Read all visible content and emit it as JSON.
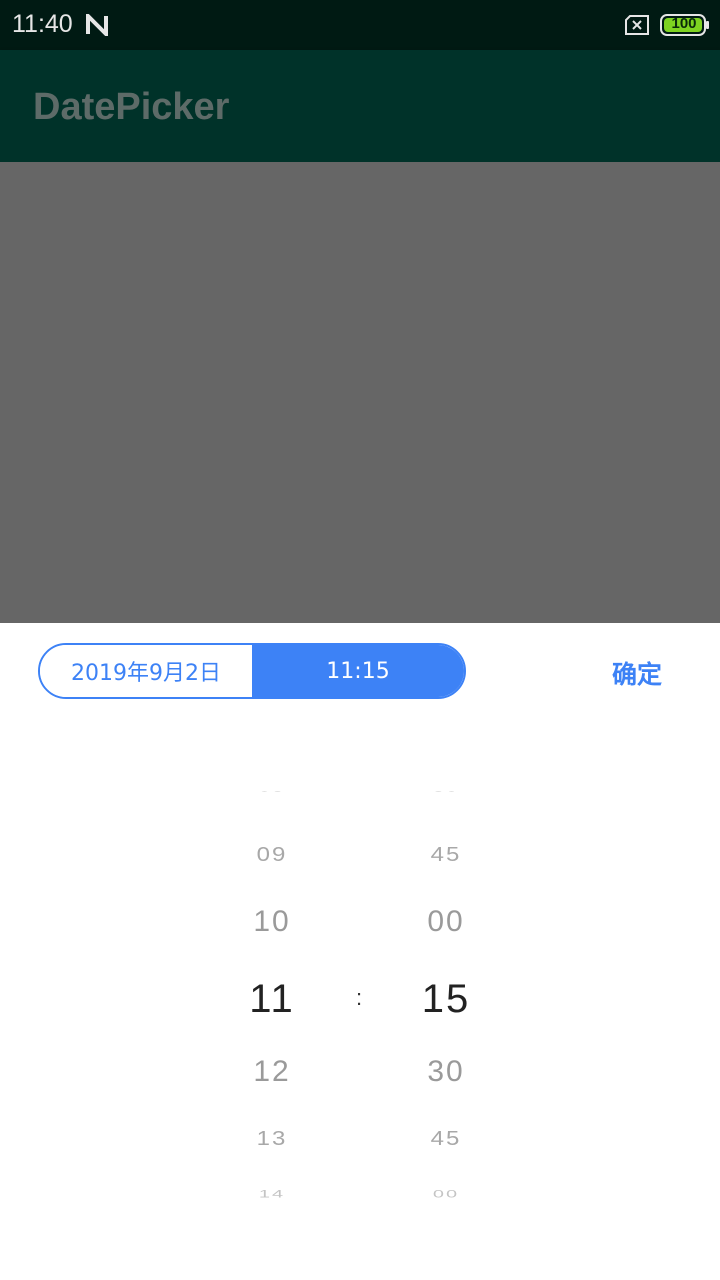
{
  "status_bar": {
    "time": "11:40",
    "battery": "100",
    "icons": [
      "notification-n-icon",
      "no-sim-icon",
      "battery-icon"
    ]
  },
  "app_bar": {
    "title": "DatePicker"
  },
  "picker": {
    "date_tab": "2019年9月2日",
    "time_tab": "11:15",
    "confirm": "确定",
    "separator": ":",
    "hours": [
      "08",
      "09",
      "10",
      "11",
      "12",
      "13",
      "14"
    ],
    "minutes": [
      "30",
      "45",
      "00",
      "15",
      "30",
      "45",
      "00"
    ],
    "selected_hour": "11",
    "selected_minute": "15"
  },
  "colors": {
    "accent": "#3d82f6",
    "app_bar": "#003229",
    "status_bar": "#001a13",
    "dim": "#666666",
    "battery_fill": "#7ed321"
  }
}
